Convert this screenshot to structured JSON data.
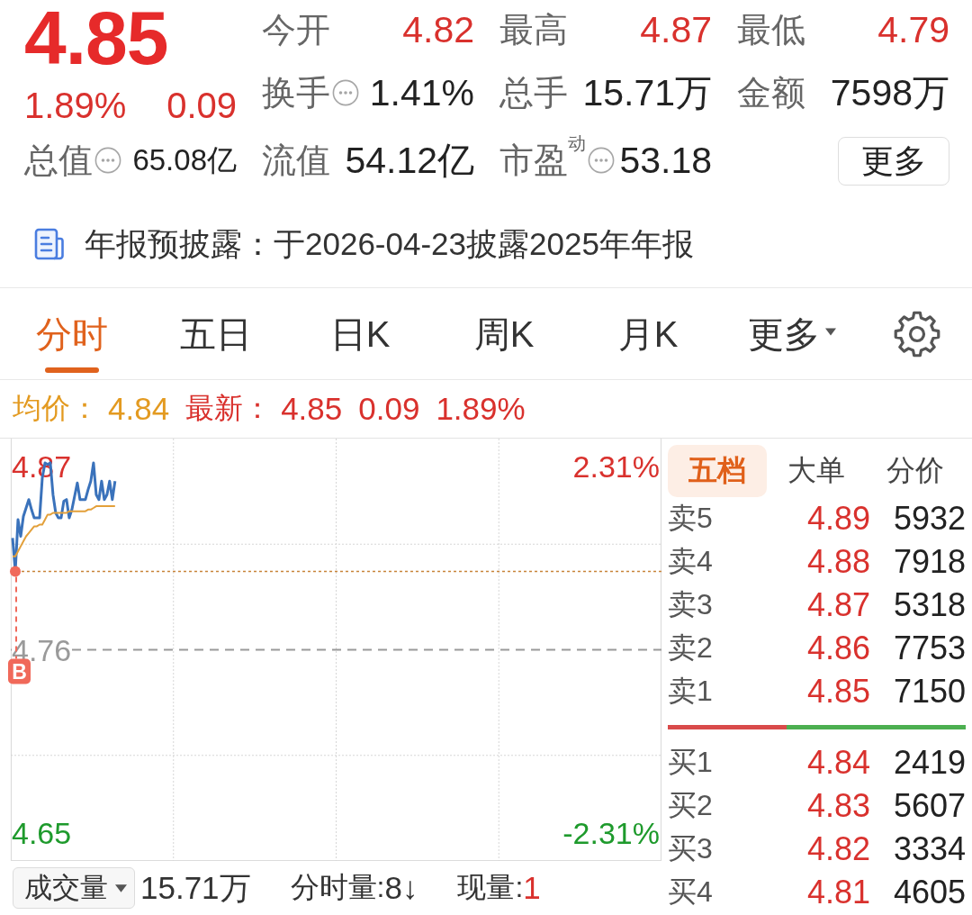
{
  "quote": {
    "price": "4.85",
    "change_pct": "1.89%",
    "change": "0.09"
  },
  "stats": [
    {
      "label": "今开",
      "value": "4.82",
      "color": "#d9312d",
      "info": false
    },
    {
      "label": "最高",
      "value": "4.87",
      "color": "#d9312d",
      "info": false
    },
    {
      "label": "最低",
      "value": "4.79",
      "color": "#d9312d",
      "info": false
    },
    {
      "label": "换手",
      "value": "1.41%",
      "info": true
    },
    {
      "label": "总手",
      "value": "15.71万",
      "info": false
    },
    {
      "label": "金额",
      "value": "7598万",
      "info": false
    },
    {
      "label": "总值",
      "value": "65.08亿",
      "info": true
    },
    {
      "label": "流值",
      "value": "54.12亿",
      "info": false
    },
    {
      "label": "市盈",
      "sup": "动",
      "value": "53.18",
      "info": true
    }
  ],
  "more_button": {
    "label": "更多"
  },
  "notice": {
    "text": "年报预披露：于2026-04-23披露2025年年报"
  },
  "tabs": [
    {
      "label": "分时",
      "selected": true,
      "kind": "tab"
    },
    {
      "label": "五日",
      "selected": false,
      "kind": "tab"
    },
    {
      "label": "日K",
      "selected": false,
      "kind": "tab"
    },
    {
      "label": "周K",
      "selected": false,
      "kind": "tab"
    },
    {
      "label": "月K",
      "selected": false,
      "kind": "tab"
    },
    {
      "label": "更多",
      "selected": false,
      "kind": "menu"
    }
  ],
  "legend": [
    {
      "kind": "average",
      "label": "均价：",
      "values": [
        "4.84"
      ]
    },
    {
      "kind": "latest",
      "label": "最新：",
      "values": [
        "4.85",
        "0.09",
        "1.89%"
      ]
    }
  ],
  "chart": {
    "chart_data": {
      "type": "line",
      "ylim": [
        4.634,
        4.886
      ],
      "yticks": [
        {
          "value": 4.65,
          "label": "4.65"
        },
        {
          "value": 4.76,
          "label": "4.76"
        },
        {
          "value": 4.87,
          "label": "4.87"
        }
      ],
      "ref_lines": [
        {
          "axis": "y",
          "value": 4.76,
          "color": "#9a9a9a"
        },
        {
          "axis": "y",
          "value": 4.807,
          "color": "#c8843a"
        }
      ],
      "series": [
        {
          "color": "#3a72bb",
          "values": [
            4.827,
            4.807,
            4.838,
            4.828,
            4.84,
            4.845,
            4.85,
            4.844,
            4.839,
            4.839,
            4.839,
            4.863,
            4.872,
            4.871,
            4.872,
            4.853,
            4.842,
            4.839,
            4.839,
            4.849,
            4.85,
            4.839,
            4.844,
            4.852,
            4.86,
            4.85,
            4.85,
            4.85,
            4.856,
            4.861,
            4.872,
            4.853,
            4.85,
            4.861,
            4.85,
            4.853,
            4.861,
            4.85,
            4.861,
            null,
            null,
            null,
            null,
            null,
            null,
            null,
            null,
            null,
            null,
            null,
            null,
            null,
            null,
            null,
            null,
            null,
            null,
            null,
            null,
            null,
            null,
            null,
            null,
            null,
            null,
            null,
            null,
            null,
            null,
            null,
            null,
            null,
            null,
            null,
            null,
            null,
            null,
            null,
            null,
            null,
            null,
            null,
            null,
            null,
            null,
            null,
            null,
            null,
            null,
            null,
            null,
            null,
            null,
            null,
            null,
            null,
            null,
            null,
            null,
            null,
            null,
            null,
            null,
            null,
            null,
            null,
            null,
            null,
            null,
            null,
            null,
            null,
            null,
            null,
            null,
            null,
            null,
            null,
            null,
            null,
            null,
            null,
            null,
            null,
            null,
            null,
            null,
            null,
            null,
            null,
            null,
            null,
            null,
            null,
            null,
            null,
            null,
            null,
            null,
            null,
            null,
            null,
            null,
            null,
            null,
            null,
            null,
            null,
            null,
            null,
            null,
            null,
            null,
            null,
            null,
            null,
            null,
            null,
            null,
            null,
            null,
            null,
            null,
            null,
            null,
            null,
            null,
            null,
            null,
            null,
            null,
            null,
            null,
            null,
            null,
            null,
            null,
            null,
            null,
            null,
            null,
            null,
            null,
            null,
            null,
            null,
            null,
            null,
            null,
            null,
            null,
            null,
            null,
            null,
            null,
            null,
            null,
            null,
            null,
            null,
            null,
            null,
            null,
            null,
            null,
            null,
            null,
            null,
            null,
            null,
            null,
            null,
            null,
            null,
            null,
            null,
            null,
            null,
            null,
            null,
            null,
            null,
            null,
            null,
            null,
            null,
            null,
            null,
            null,
            null,
            null,
            null,
            null,
            null,
            null,
            null,
            null,
            null,
            null,
            null,
            null
          ]
        },
        {
          "color": "#e3a03a",
          "values": [
            4.816,
            4.816,
            4.819,
            4.822,
            4.825,
            4.828,
            4.83,
            4.832,
            4.834,
            4.834,
            4.835,
            4.835,
            4.838,
            4.841,
            4.841,
            4.842,
            4.842,
            4.842,
            4.842,
            4.842,
            4.842,
            4.843,
            4.843,
            4.843,
            4.843,
            4.843,
            4.843,
            4.843,
            4.844,
            4.844,
            4.845,
            4.846,
            4.846,
            4.846,
            4.846,
            4.846,
            4.846,
            4.846,
            4.846,
            null,
            null,
            null,
            null,
            null,
            null,
            null,
            null,
            null,
            null,
            null,
            null,
            null,
            null,
            null,
            null,
            null,
            null,
            null,
            null,
            null,
            null,
            null,
            null,
            null,
            null,
            null,
            null,
            null,
            null,
            null,
            null,
            null,
            null,
            null,
            null,
            null,
            null,
            null,
            null,
            null,
            null,
            null,
            null,
            null,
            null,
            null,
            null,
            null,
            null,
            null,
            null,
            null,
            null,
            null,
            null,
            null,
            null,
            null,
            null,
            null,
            null,
            null,
            null,
            null,
            null,
            null,
            null,
            null,
            null,
            null,
            null,
            null,
            null,
            null,
            null,
            null,
            null,
            null,
            null,
            null,
            null,
            null,
            null,
            null,
            null,
            null,
            null,
            null,
            null,
            null,
            null,
            null,
            null,
            null,
            null,
            null,
            null,
            null,
            null,
            null,
            null,
            null,
            null,
            null,
            null,
            null,
            null,
            null,
            null,
            null,
            null,
            null,
            null,
            null,
            null,
            null,
            null,
            null,
            null,
            null,
            null,
            null,
            null,
            null,
            null,
            null,
            null,
            null,
            null,
            null,
            null,
            null,
            null,
            null,
            null,
            null,
            null,
            null,
            null,
            null,
            null,
            null,
            null,
            null,
            null,
            null,
            null,
            null,
            null,
            null,
            null,
            null,
            null,
            null,
            null,
            null,
            null,
            null,
            null,
            null,
            null,
            null,
            null,
            null,
            null,
            null,
            null,
            null,
            null,
            null,
            null,
            null,
            null,
            null,
            null,
            null,
            null,
            null,
            null,
            null,
            null,
            null,
            null,
            null,
            null,
            null,
            null,
            null,
            null,
            null,
            null,
            null,
            null,
            null,
            null,
            null,
            null,
            null,
            null,
            null,
            null
          ]
        }
      ]
    },
    "pct_labels": [
      {
        "text": "2.31%",
        "color": "#d9312d"
      },
      {
        "text": "-2.31%",
        "color": "#1e9a2c"
      }
    ],
    "buy_marker": {
      "label": "B"
    }
  },
  "volume_bar": {
    "selector": "成交量",
    "total": "15.71万",
    "items": [
      {
        "label": "分时量:",
        "value": "8↓"
      },
      {
        "label": "现量:",
        "value": "1",
        "color": "#d9312d"
      }
    ]
  },
  "order_book": {
    "tabs": [
      {
        "label": "五档",
        "selected": true
      },
      {
        "label": "大单",
        "selected": false
      },
      {
        "label": "分价",
        "selected": false
      }
    ],
    "asks": [
      {
        "label": "卖5",
        "price": "4.89",
        "volume": "5932"
      },
      {
        "label": "卖4",
        "price": "4.88",
        "volume": "7918"
      },
      {
        "label": "卖3",
        "price": "4.87",
        "volume": "5318"
      },
      {
        "label": "卖2",
        "price": "4.86",
        "volume": "7753"
      },
      {
        "label": "卖1",
        "price": "4.85",
        "volume": "7150"
      }
    ],
    "ratio": {
      "level": 0.4
    },
    "bids": [
      {
        "label": "买1",
        "price": "4.84",
        "volume": "2419"
      },
      {
        "label": "买2",
        "price": "4.83",
        "volume": "5607"
      },
      {
        "label": "买3",
        "price": "4.82",
        "volume": "3334"
      },
      {
        "label": "买4",
        "price": "4.81",
        "volume": "4605"
      }
    ]
  }
}
